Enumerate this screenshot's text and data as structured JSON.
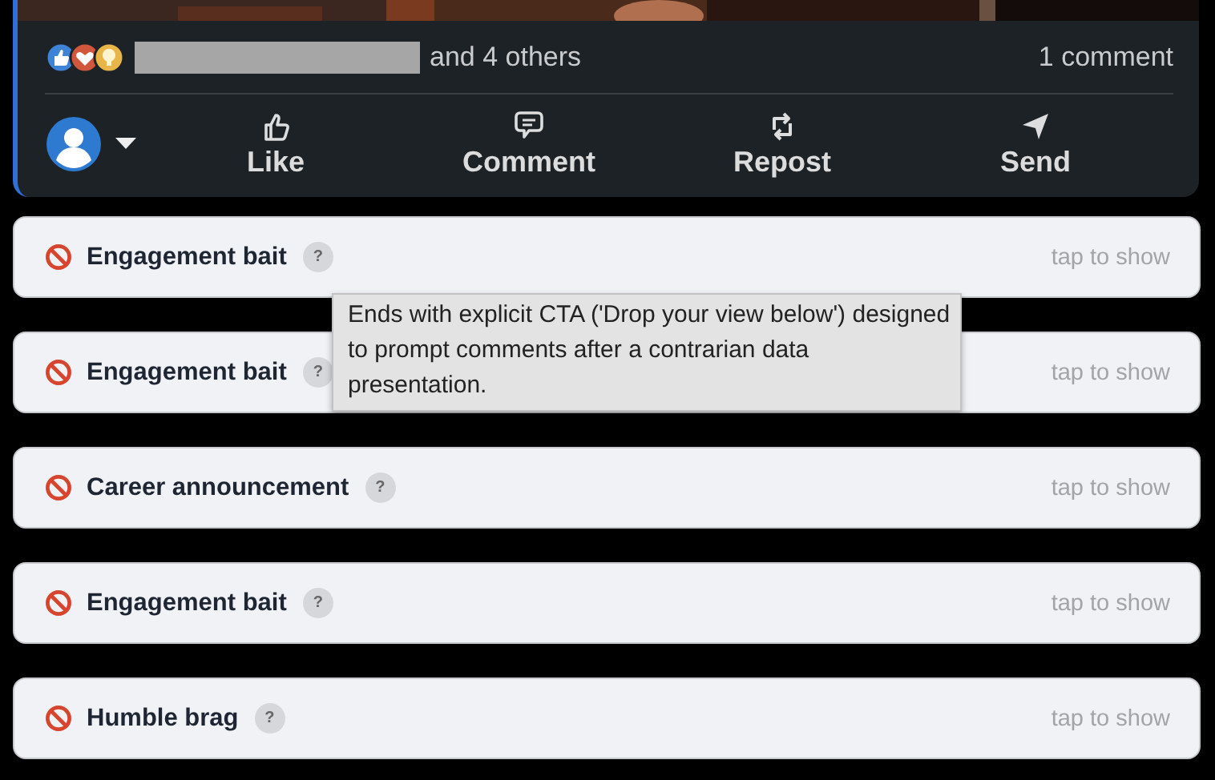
{
  "post": {
    "reactions_text": "and 4 others",
    "comments": "1 comment",
    "actions": [
      {
        "kind": "like",
        "label": "Like"
      },
      {
        "kind": "comment",
        "label": "Comment"
      },
      {
        "kind": "repost",
        "label": "Repost"
      },
      {
        "kind": "send",
        "label": "Send"
      }
    ]
  },
  "flags": [
    {
      "label": "Engagement bait",
      "hint": "?",
      "action": "tap to show"
    },
    {
      "label": "Engagement bait",
      "hint": "?",
      "action": "tap to show"
    },
    {
      "label": "Career announcement",
      "hint": "?",
      "action": "tap to show"
    },
    {
      "label": "Engagement bait",
      "hint": "?",
      "action": "tap to show"
    },
    {
      "label": "Humble brag",
      "hint": "?",
      "action": "tap to show"
    }
  ],
  "tooltip": {
    "text": "Ends with explicit CTA ('Drop your view below') designed to prompt comments after a contrarian data presentation."
  }
}
